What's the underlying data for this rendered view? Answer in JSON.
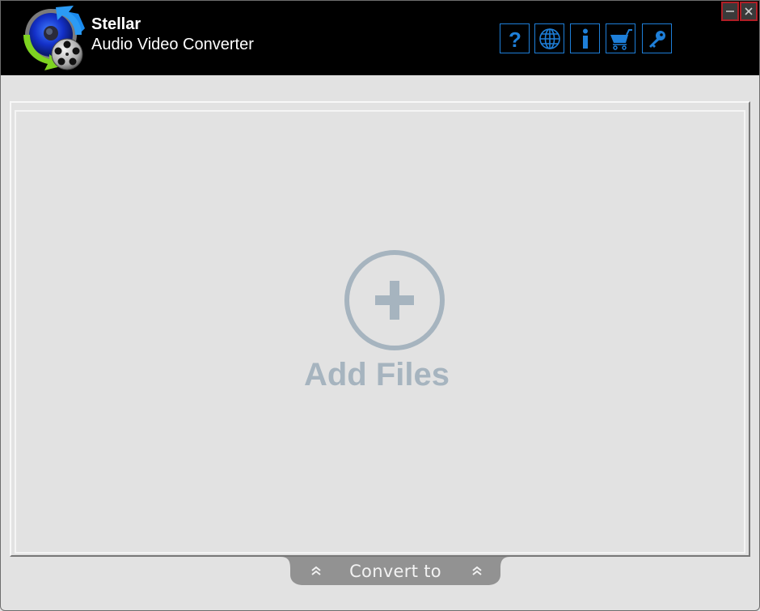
{
  "app": {
    "brand": "Stellar",
    "product": "Audio Video Converter",
    "logo_icon": "audio-video-converter-logo"
  },
  "toolbar": {
    "buttons": [
      {
        "name": "help",
        "icon": "question-mark-icon",
        "glyph": "?"
      },
      {
        "name": "language",
        "icon": "globe-icon"
      },
      {
        "name": "info",
        "icon": "info-icon",
        "glyph": "i"
      },
      {
        "name": "buy",
        "icon": "cart-icon"
      },
      {
        "name": "activate",
        "icon": "key-icon"
      }
    ],
    "accent_color": "#1e7fd9"
  },
  "window_controls": {
    "minimize_glyph": "–",
    "close_glyph": "✕",
    "border_color": "#b01e26"
  },
  "main": {
    "add_files_label": "Add Files",
    "add_files_icon": "plus-circle-icon",
    "placeholder_color": "#a6b4bf"
  },
  "footer": {
    "convert_to_label": "Convert to",
    "chevron_icon": "double-chevron-up-icon"
  }
}
